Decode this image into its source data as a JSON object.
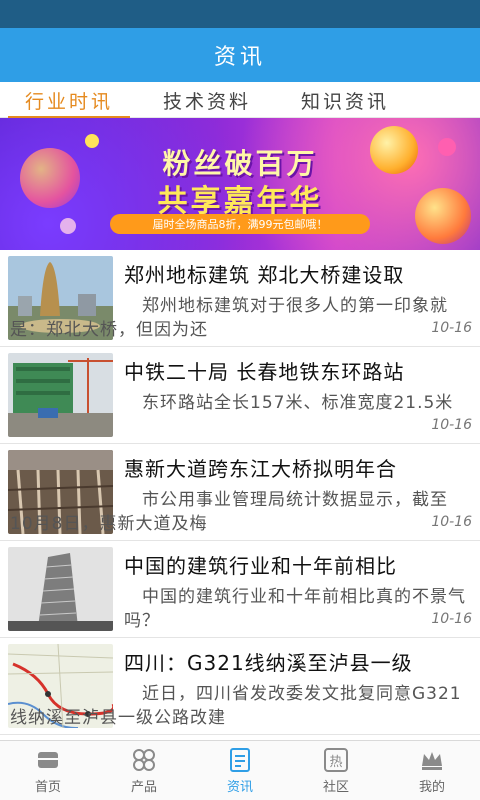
{
  "header": {
    "title": "资讯"
  },
  "tabs": [
    {
      "label": "行业时讯",
      "active": true
    },
    {
      "label": "技术资料",
      "active": false
    },
    {
      "label": "知识资讯",
      "active": false
    }
  ],
  "banner": {
    "line1": "粉丝破百万",
    "line2": "共享嘉年华",
    "subtitle": "届时全场商品8折，满99元包邮哦！"
  },
  "news": [
    {
      "title": "郑州地标建筑 郑北大桥建设取",
      "summary": "郑州地标建筑对于很多人的第一印象就是：郑北大桥，但因为还",
      "date": "10-16",
      "thumb": "tower-photo"
    },
    {
      "title": "中铁二十局 长春地铁东环路站",
      "summary": "东环路站全长157米、标准宽度21.5米",
      "date": "10-16",
      "thumb": "construction-site-photo"
    },
    {
      "title": "惠新大道跨东江大桥拟明年合",
      "summary": "市公用事业管理局统计数据显示，截至10月8日，惠新大道及梅",
      "date": "10-16",
      "thumb": "rebar-photo"
    },
    {
      "title": "中国的建筑行业和十年前相比",
      "summary": "中国的建筑行业和十年前相比真的不景气吗？",
      "date": "10-16",
      "thumb": "skyscraper-photo"
    },
    {
      "title": "四川：G321线纳溪至泸县一级",
      "summary": "近日，四川省发改委发文批复同意G321线纳溪至泸县一级公路改建",
      "date": "10-16",
      "thumb": "map-photo"
    }
  ],
  "tabbar": [
    {
      "label": "首页",
      "icon": "home-icon",
      "active": false
    },
    {
      "label": "产品",
      "icon": "product-icon",
      "active": false
    },
    {
      "label": "资讯",
      "icon": "news-icon",
      "active": true
    },
    {
      "label": "社区",
      "icon": "community-icon",
      "active": false
    },
    {
      "label": "我的",
      "icon": "crown-icon",
      "active": false
    }
  ],
  "colors": {
    "accent": "#2f9ee6",
    "tab_active": "#e58a1f",
    "status_bar": "#1f5d86"
  }
}
